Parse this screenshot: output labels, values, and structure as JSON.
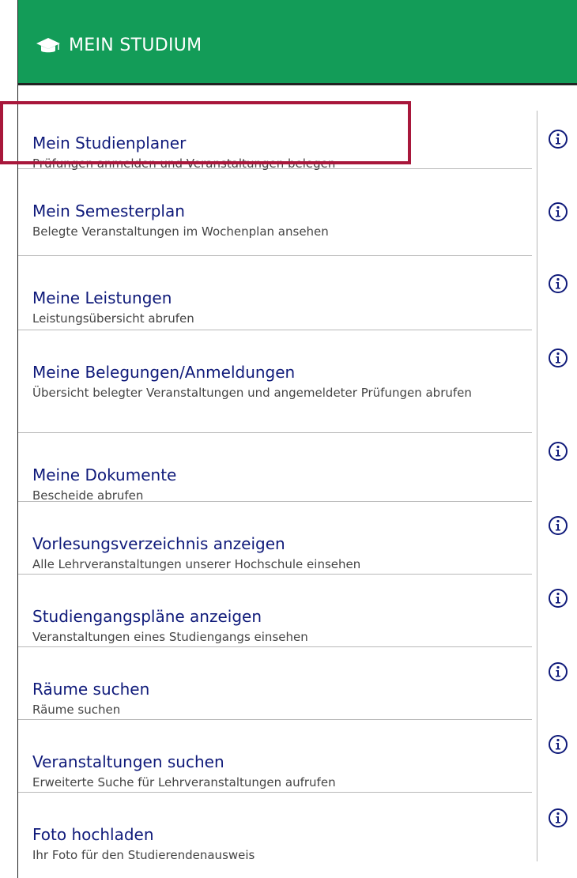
{
  "header": {
    "title": "MEIN STUDIUM",
    "icon": "graduation-cap-icon",
    "background": "#139c58"
  },
  "items": [
    {
      "title": "Mein Studienplaner",
      "subtitle": "Prüfungen anmelden und Veranstaltungen belegen"
    },
    {
      "title": "Mein Semesterplan",
      "subtitle": "Belegte Veranstaltungen im Wochenplan ansehen"
    },
    {
      "title": "Meine Leistungen",
      "subtitle": "Leistungsübersicht abrufen"
    },
    {
      "title": "Meine Belegungen/Anmeldungen",
      "subtitle": "Übersicht belegter Veranstaltungen und angemeldeter Prüfungen abrufen"
    },
    {
      "title": "Meine Dokumente",
      "subtitle": "Bescheide abrufen"
    },
    {
      "title": "Vorlesungsverzeichnis anzeigen",
      "subtitle": "Alle Lehrveranstaltungen unserer Hochschule einsehen"
    },
    {
      "title": "Studiengangspläne anzeigen",
      "subtitle": "Veranstaltungen eines Studiengangs einsehen"
    },
    {
      "title": "Räume suchen",
      "subtitle": "Räume suchen"
    },
    {
      "title": "Veranstaltungen suchen",
      "subtitle": "Erweiterte Suche für Lehrveranstaltungen aufrufen"
    },
    {
      "title": "Foto hochladen",
      "subtitle": "Ihr Foto für den Studierendenausweis"
    }
  ],
  "colors": {
    "link": "#0f1a7a",
    "highlight": "#a8173b"
  }
}
